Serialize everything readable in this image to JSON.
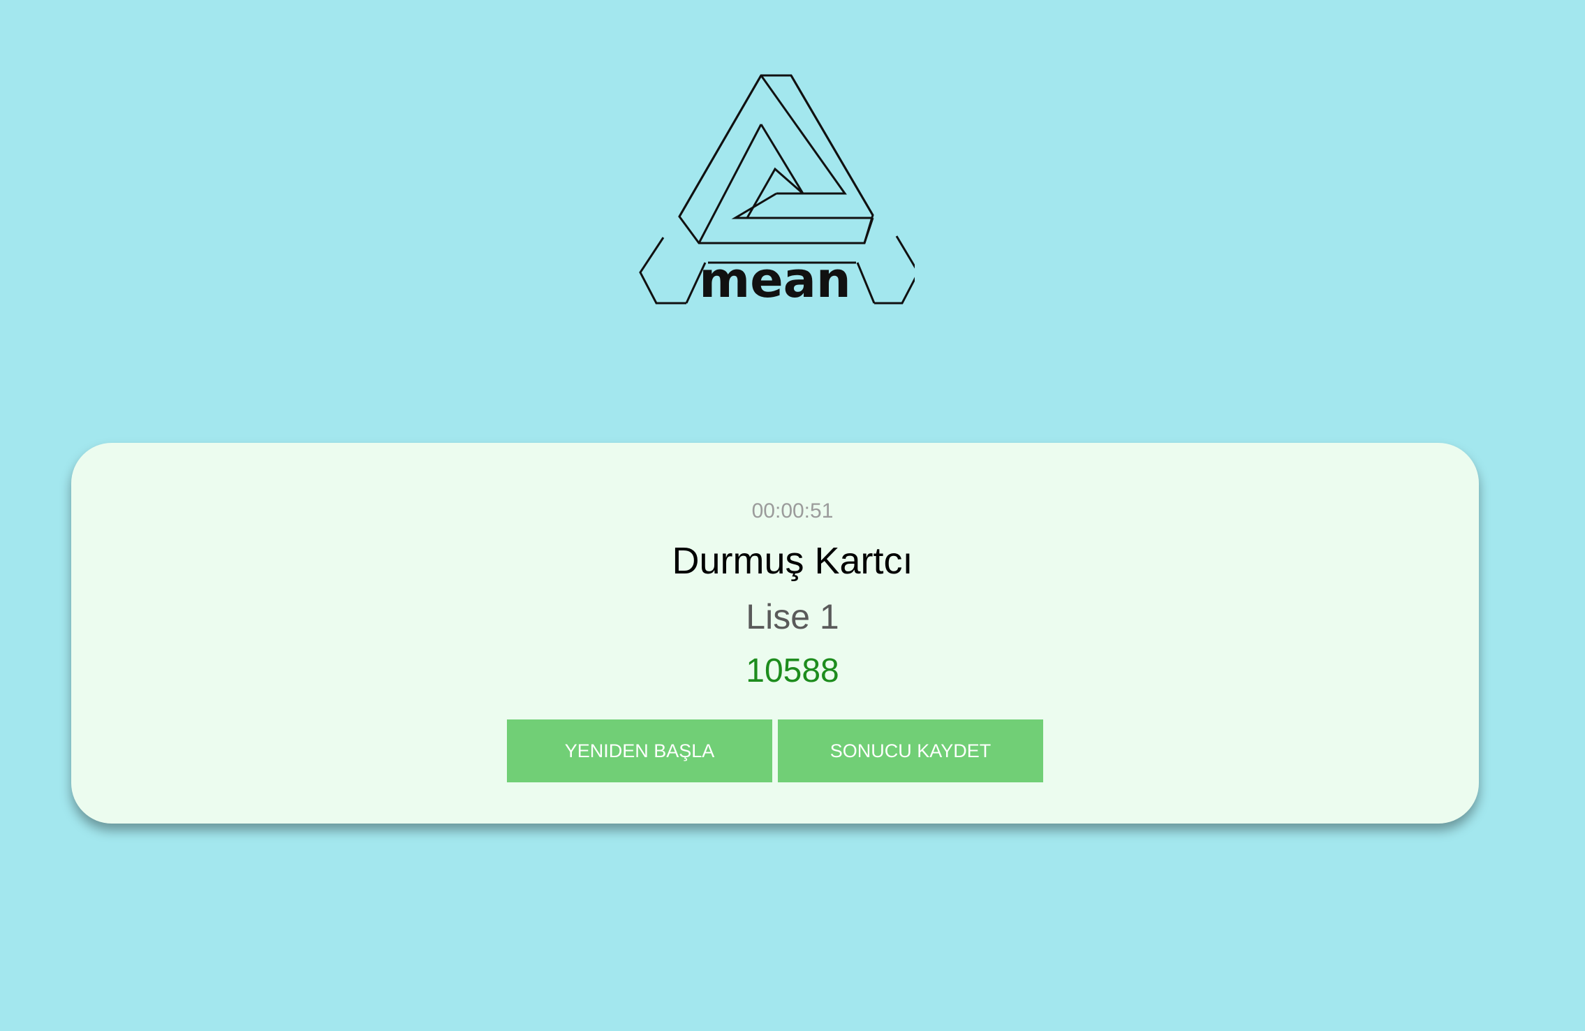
{
  "logo": {
    "text": "mean",
    "icon": "impossible-triangle-logo"
  },
  "result": {
    "timer": "00:00:51",
    "player_name": "Durmuş Kartcı",
    "level": "Lise 1",
    "score": "10588"
  },
  "actions": {
    "restart_label": "YENIDEN BAŞLA",
    "save_label": "SONUCU KAYDET"
  },
  "colors": {
    "background": "#a3e7ee",
    "card": "#ecfcef",
    "button": "#71cf76",
    "score": "#1d8c1d"
  }
}
